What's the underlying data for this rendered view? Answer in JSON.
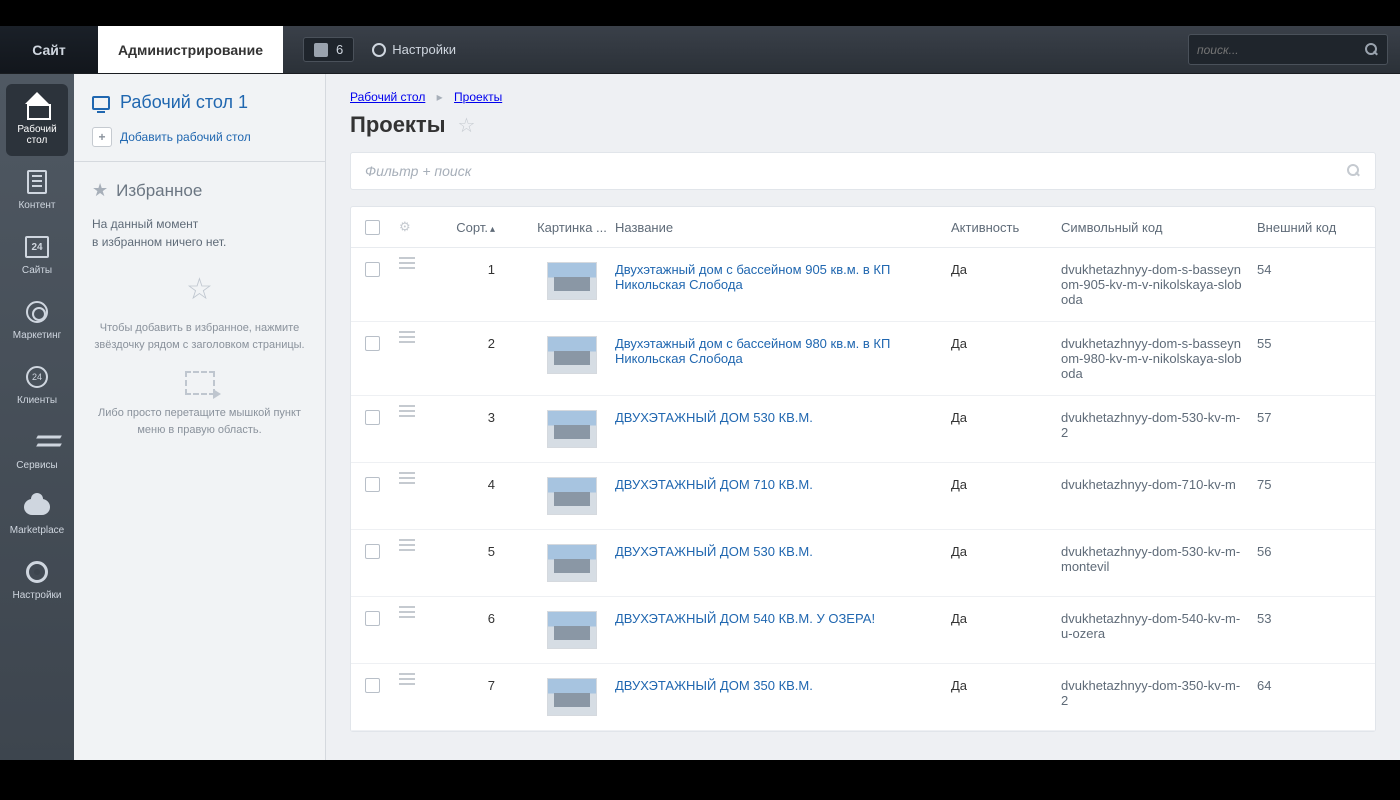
{
  "top": {
    "site": "Сайт",
    "admin": "Администрирование",
    "badge": "6",
    "settings": "Настройки",
    "search_placeholder": "поиск..."
  },
  "rail": {
    "desktop": "Рабочий стол",
    "content": "Контент",
    "sites": "Сайты",
    "sites_num": "24",
    "marketing": "Маркетинг",
    "clients": "Клиенты",
    "clients_num": "24",
    "services": "Сервисы",
    "marketplace": "Marketplace",
    "settings": "Настройки"
  },
  "panel": {
    "desktop_title": "Рабочий стол 1",
    "add_desktop": "Добавить рабочий стол",
    "fav_title": "Избранное",
    "fav_empty1": "На данный момент",
    "fav_empty2": "в избранном ничего нет.",
    "fav_hint1": "Чтобы добавить в избранное, нажмите звёздочку рядом с заголовком страницы.",
    "fav_hint2": "Либо просто перетащите мышкой пункт меню в правую область."
  },
  "main": {
    "crumb1": "Рабочий стол",
    "crumb2": "Проекты",
    "title": "Проекты",
    "filter_placeholder": "Фильтр + поиск"
  },
  "columns": {
    "sort": "Сорт.",
    "image": "Картинка ...",
    "name": "Название",
    "active": "Активность",
    "code": "Символьный код",
    "ext": "Внешний код"
  },
  "rows": [
    {
      "sort": "1",
      "name": "Двухэтажный дом с бассейном 905 кв.м. в КП Никольская Слобода",
      "active": "Да",
      "code": "dvukhetazhnyy-dom-s-basseynom-905-kv-m-v-nikolskaya-sloboda",
      "ext": "54"
    },
    {
      "sort": "2",
      "name": "Двухэтажный дом с бассейном 980 кв.м. в КП Никольская Слобода",
      "active": "Да",
      "code": "dvukhetazhnyy-dom-s-basseynom-980-kv-m-v-nikolskaya-sloboda",
      "ext": "55"
    },
    {
      "sort": "3",
      "name": "ДВУХЭТАЖНЫЙ ДОМ 530 КВ.М.",
      "active": "Да",
      "code": "dvukhetazhnyy-dom-530-kv-m-2",
      "ext": "57"
    },
    {
      "sort": "4",
      "name": "ДВУХЭТАЖНЫЙ ДОМ 710 КВ.М.",
      "active": "Да",
      "code": "dvukhetazhnyy-dom-710-kv-m",
      "ext": "75"
    },
    {
      "sort": "5",
      "name": "ДВУХЭТАЖНЫЙ ДОМ 530 КВ.М.",
      "active": "Да",
      "code": "dvukhetazhnyy-dom-530-kv-m-montevil",
      "ext": "56"
    },
    {
      "sort": "6",
      "name": "ДВУХЭТАЖНЫЙ ДОМ 540 КВ.М. У ОЗЕРА!",
      "active": "Да",
      "code": "dvukhetazhnyy-dom-540-kv-m-u-ozera",
      "ext": "53"
    },
    {
      "sort": "7",
      "name": "ДВУХЭТАЖНЫЙ ДОМ 350 КВ.М.",
      "active": "Да",
      "code": "dvukhetazhnyy-dom-350-kv-m-2",
      "ext": "64"
    }
  ]
}
